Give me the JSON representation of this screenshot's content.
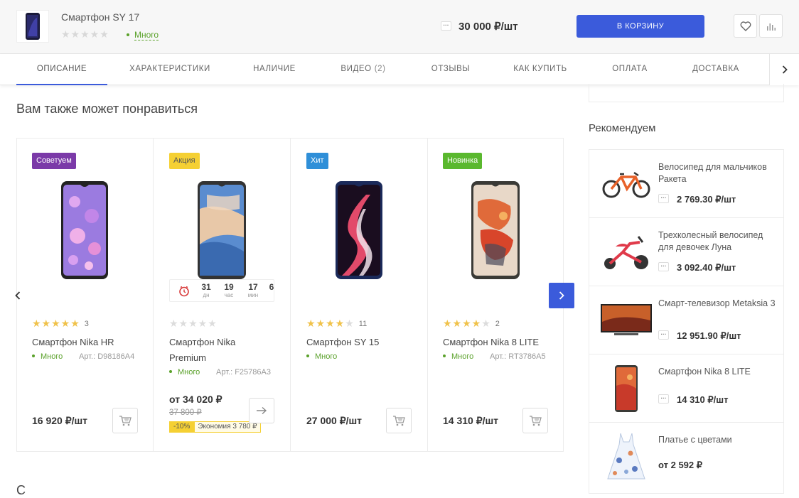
{
  "header": {
    "product_title": "Смартфон SY 17",
    "stock_label": "Много",
    "qty_label": "···",
    "price": "30 000 ₽/шт",
    "cart_button": "В КОРЗИНУ"
  },
  "tabs": [
    {
      "label": "ОПИСАНИЕ"
    },
    {
      "label": "ХАРАКТЕРИСТИКИ"
    },
    {
      "label": "НАЛИЧИЕ"
    },
    {
      "label": "ВИДЕО",
      "count": "(2)"
    },
    {
      "label": "ОТЗЫВЫ"
    },
    {
      "label": "КАК КУПИТЬ"
    },
    {
      "label": "ОПЛАТА"
    },
    {
      "label": "ДОСТАВКА"
    }
  ],
  "main": {
    "section_title": "Вам также может понравиться",
    "products": [
      {
        "badge": "Советуем",
        "badge_color": "#7b3aa8",
        "rating_count": "3",
        "rating": 5,
        "name": "Смартфон Nika HR",
        "stock": "Много",
        "article": "Арт.: D98186A4",
        "price": "16 920 ₽/шт"
      },
      {
        "badge": "Акция",
        "badge_color": "#f5d033",
        "rating": 0,
        "name": "Смартфон Nika Premium",
        "stock": "Много",
        "article": "Арт.: F25786A3",
        "timer": {
          "days": "31",
          "days_unit": "дн",
          "hours": "19",
          "hours_unit": "час",
          "mins": "17",
          "mins_unit": "мин",
          "secs": "6"
        },
        "price_from": "от 34 020 ₽",
        "old_price": "37 800 ₽",
        "discount": "-10%",
        "economy": "Экономия 3 780 ₽"
      },
      {
        "badge": "Хит",
        "badge_color": "#2f8fd8",
        "rating_count": "11",
        "rating": 4,
        "name": "Смартфон SY 15",
        "stock": "Много",
        "price": "27 000 ₽/шт"
      },
      {
        "badge": "Новинка",
        "badge_color": "#5ab82e",
        "rating_count": "2",
        "rating": 4,
        "name": "Смартфон Nika 8 LITE",
        "stock": "Много",
        "article": "Арт.: RT3786A5",
        "price": "14 310 ₽/шт"
      }
    ],
    "bottom_heading_partial": "С"
  },
  "sidebar": {
    "title": "Рекомендуем",
    "items": [
      {
        "name": "Велосипед для мальчиков Ракета",
        "price": "2 769.30 ₽/шт"
      },
      {
        "name": "Трехколесный велосипед для девочек Луна",
        "price": "3 092.40 ₽/шт"
      },
      {
        "name": "Смарт-телевизор Metaksia 3",
        "price": "12 951.90 ₽/шт"
      },
      {
        "name": "Смартфон Nika 8 LITE",
        "price": "14 310 ₽/шт"
      },
      {
        "name": "Платье с цветами",
        "price": "от 2 592 ₽"
      }
    ]
  },
  "colors": {
    "accent": "#3b5bdb",
    "stock_green": "#5aa12a",
    "star": "#f0c24a"
  },
  "icons": [
    "heart-icon",
    "compare-icon",
    "chevron-right-icon",
    "chevron-left-icon",
    "cart-icon",
    "arrow-right-icon",
    "clock-icon"
  ]
}
